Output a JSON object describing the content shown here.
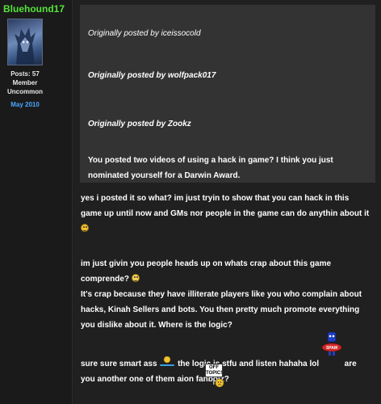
{
  "user": {
    "username": "Bluehound17",
    "posts": "Posts: 57",
    "group": "Member",
    "rank": "Uncommon",
    "joined": "May 2010"
  },
  "quote": {
    "head1": "Originally posted by iceissocold",
    "head2": "Originally posted by wolfpack017",
    "head3": "Originally posted by Zookz",
    "text": "You posted two videos of using a hack in game? I think you just nominated yourself for a Darwin Award."
  },
  "post": {
    "p1": "yes i posted it so what? im just tryin to show that you can hack in this game up until now and GMs nor people in the game can  do anythin about it",
    "p2": "im just givin you people heads up on whats crap about this game comprende?",
    "p3": "It's crap because they have illiterate players like you who complain about hacks, Kinah Sellers and bots. You then pretty much promote everything you dislike about it. Where is the logic?",
    "p4a": "sure sure smart ass",
    "p4b": "the logic is stfu and listen hahaha lol",
    "p4c": "are you another one of them aion fanboiz?"
  },
  "badges": {
    "off_topic": "OFF TOPIC!",
    "spam": "SPAM"
  },
  "colors": {
    "username": "#55e33a",
    "joined": "#4aa6ff",
    "quote_bg": "#333333",
    "page_bg": "#202020"
  }
}
